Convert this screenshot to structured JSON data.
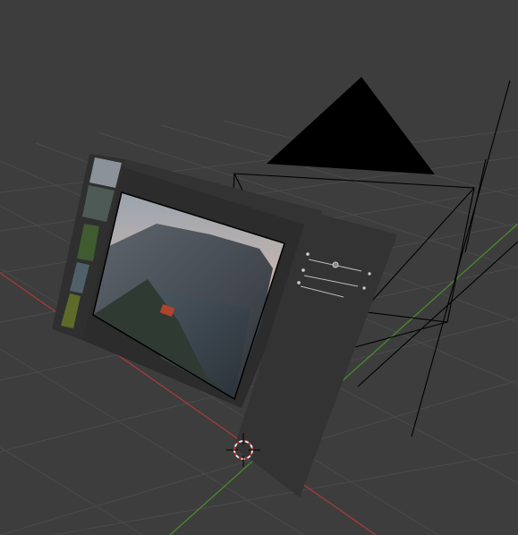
{
  "viewport": {
    "background": "#3d3d3d",
    "grid_color": "#4a4a4a",
    "axis_x_color": "#a83a3a",
    "axis_y_color": "#4a8a2a"
  },
  "scene": {
    "ui_panel_color": "#2c2c2c",
    "side_panel_color": "#333333",
    "thumbnail_strip_color": "#2f2f2f",
    "camera_lines_color": "#000000"
  },
  "side_panel": {
    "sliders": [
      {
        "label": "",
        "value": 0.45
      },
      {
        "label": "",
        "value": 0.6
      },
      {
        "label": "",
        "value": 0.3
      }
    ]
  },
  "icons": {
    "cursor": "3d-cursor-icon",
    "camera": "camera-icon"
  }
}
